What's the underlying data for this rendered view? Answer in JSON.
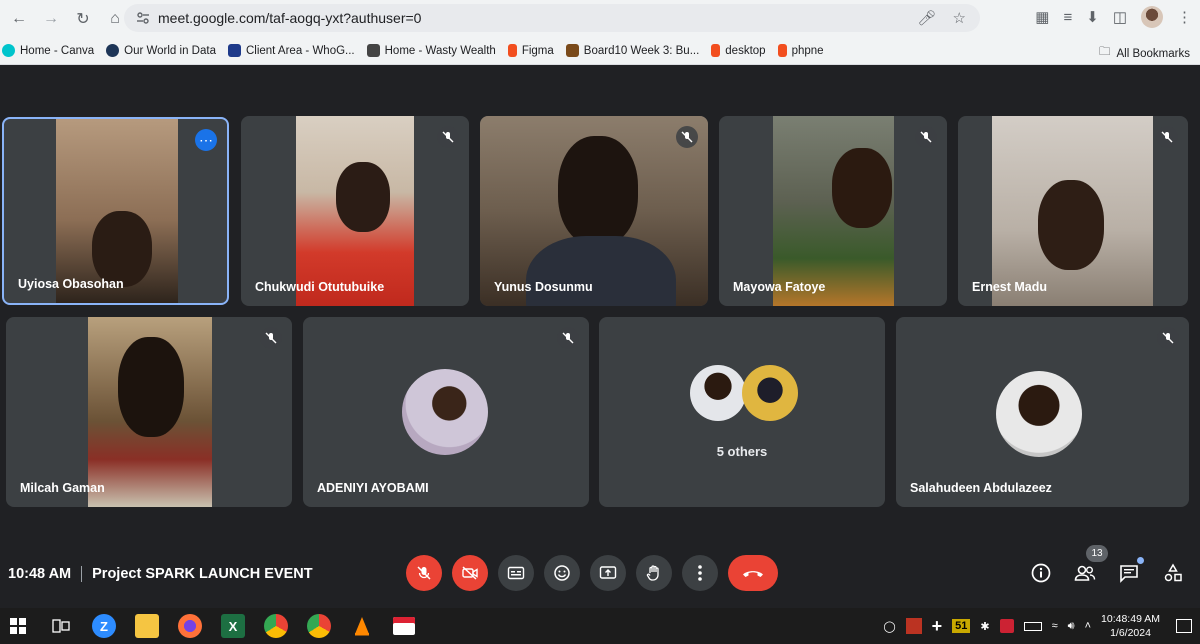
{
  "browser": {
    "url": "meet.google.com/taf-aogq-yxt?authuser=0",
    "bookmarks": [
      {
        "label": "Home - Canva",
        "color": "#00c4cc"
      },
      {
        "label": "Our World in Data",
        "color": "#1d3557"
      },
      {
        "label": "Client Area - WhoG...",
        "color": "#1e3a8a"
      },
      {
        "label": "Home - Wasty Wealth",
        "color": "#444444"
      },
      {
        "label": "Figma",
        "color": "#f24e1e"
      },
      {
        "label": "Board10 Week 3: Bu...",
        "color": "#7a4a1a"
      },
      {
        "label": "desktop",
        "color": "#f24e1e"
      },
      {
        "label": "phpne",
        "color": "#f24e1e"
      }
    ],
    "all_bookmarks": "All Bookmarks"
  },
  "participants": [
    {
      "name": "Uyiosa Obasohan"
    },
    {
      "name": "Chukwudi Otutubuike"
    },
    {
      "name": "Yunus Dosunmu"
    },
    {
      "name": "Mayowa Fatoye"
    },
    {
      "name": "Ernest Madu"
    },
    {
      "name": "Milcah Gaman"
    },
    {
      "name": "ADENIYI AYOBAMI"
    },
    {
      "name": "Salahudeen Abdulazeez"
    }
  ],
  "others_label": "5 others",
  "meeting": {
    "time": "10:48 AM",
    "title": "Project SPARK LAUNCH EVENT",
    "people_count": "13"
  },
  "taskbar": {
    "time": "10:48:49 AM",
    "date": "1/6/2024",
    "tray_count": "51"
  },
  "colors": {
    "tile_bg": "#3c4043",
    "stage_bg": "#202124",
    "danger": "#ea4335",
    "active_border": "#8ab4f8",
    "accent": "#1a73e8"
  }
}
